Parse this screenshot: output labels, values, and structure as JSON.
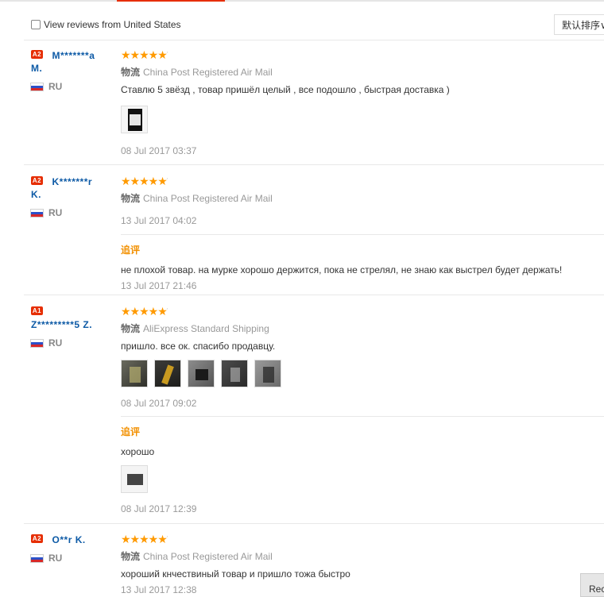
{
  "filter": {
    "checkbox_label": "View reviews from United States",
    "sort_label": "默认排序∨"
  },
  "reviews": [
    {
      "badge": "A2",
      "name_line1": "M*******a",
      "name_line2": "M.",
      "country": "RU",
      "stars": "★★★★★",
      "logistics_label": "物流",
      "shipping": "China Post Registered Air Mail",
      "text": "Ставлю 5 звёзд , товар пришёл целый , все подошло , быстрая доставка )",
      "date": "08 Jul 2017 03:37"
    },
    {
      "badge": "A2",
      "name_line1": "K*******r",
      "name_line2": "K.",
      "country": "RU",
      "stars": "★★★★★",
      "logistics_label": "物流",
      "shipping": "China Post Registered Air Mail",
      "date": "13 Jul 2017 04:02",
      "followup": {
        "label": "追评",
        "text": "не плохой товар. на мурке хорошо держится, пока не стрелял, не знаю как выстрел будет держать!",
        "date": "13 Jul 2017 21:46"
      }
    },
    {
      "badge": "A1",
      "name_line1": "Z*********5 Z.",
      "country": "RU",
      "stars": "★★★★★",
      "logistics_label": "物流",
      "shipping": "AliExpress Standard Shipping",
      "text": "пришло. все ок. спасибо продавцу.",
      "date": "08 Jul 2017 09:02",
      "followup": {
        "label": "追评",
        "text": "хорошо",
        "date": "08 Jul 2017 12:39"
      }
    },
    {
      "badge": "A2",
      "name_line1": "O**r K.",
      "country": "RU",
      "stars": "★★★★★",
      "logistics_label": "物流",
      "shipping": "China Post Registered Air Mail",
      "text": "хороший кнчествиный товар и пришло тожа быстро",
      "date": "13 Jul 2017 12:38"
    }
  ],
  "side_button_label": "Rec"
}
